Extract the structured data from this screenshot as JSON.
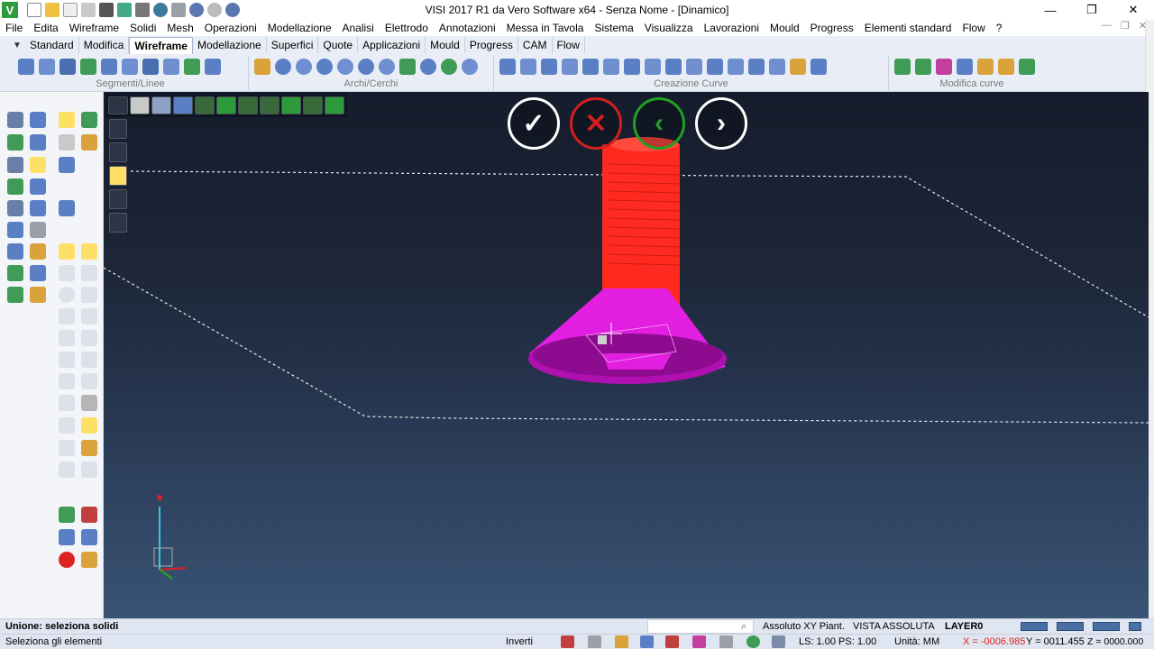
{
  "window": {
    "title": "VISI 2017 R1   da Vero Software x64 - Senza Nome - [Dinamico]",
    "app_icon_letter": "V",
    "minimize": "—",
    "restore": "❐",
    "close": "✕"
  },
  "menu": [
    "File",
    "Edita",
    "Wireframe",
    "Solidi",
    "Mesh",
    "Operazioni",
    "Modellazione",
    "Analisi",
    "Elettrodo",
    "Annotazioni",
    "Messa in Tavola",
    "Sistema",
    "Visualizza",
    "Lavorazioni",
    "Mould",
    "Progress",
    "Elementi standard",
    "Flow",
    "?"
  ],
  "tabs": [
    "Standard",
    "Modifica",
    "Wireframe",
    "Modellazione",
    "Superfici",
    "Quote",
    "Applicazioni",
    "Mould",
    "Progress",
    "CAM",
    "Flow"
  ],
  "active_tab": "Wireframe",
  "ribbon_groups": [
    "Segmenti/Linee",
    "Archi/Cerchi",
    "Creazione Curve",
    "Modifica curve"
  ],
  "confirm_buttons": {
    "ok": "✓",
    "cancel": "✕",
    "back": "‹",
    "next": "›"
  },
  "status": {
    "line1": "Unione: seleziona solidi",
    "line2": "Seleziona gli elementi",
    "view_mode": "Assoluto XY Piant.",
    "view_name": "VISTA ASSOLUTA",
    "layer": "LAYER0",
    "invert": "Inverti",
    "scale": "LS: 1.00 PS: 1.00",
    "units": "Unità: MM",
    "x": "X = -0006.985",
    "y": "Y = 0011.455",
    "z": "Z = 0000.000"
  },
  "colors": {
    "accent_tab": "#ffffff",
    "screw_shank": "#ff2a1f",
    "screw_head": "#e21ee0",
    "ok_button": "#ffffff",
    "cancel_button": "#d21f1f",
    "back_button": "#21a021"
  }
}
